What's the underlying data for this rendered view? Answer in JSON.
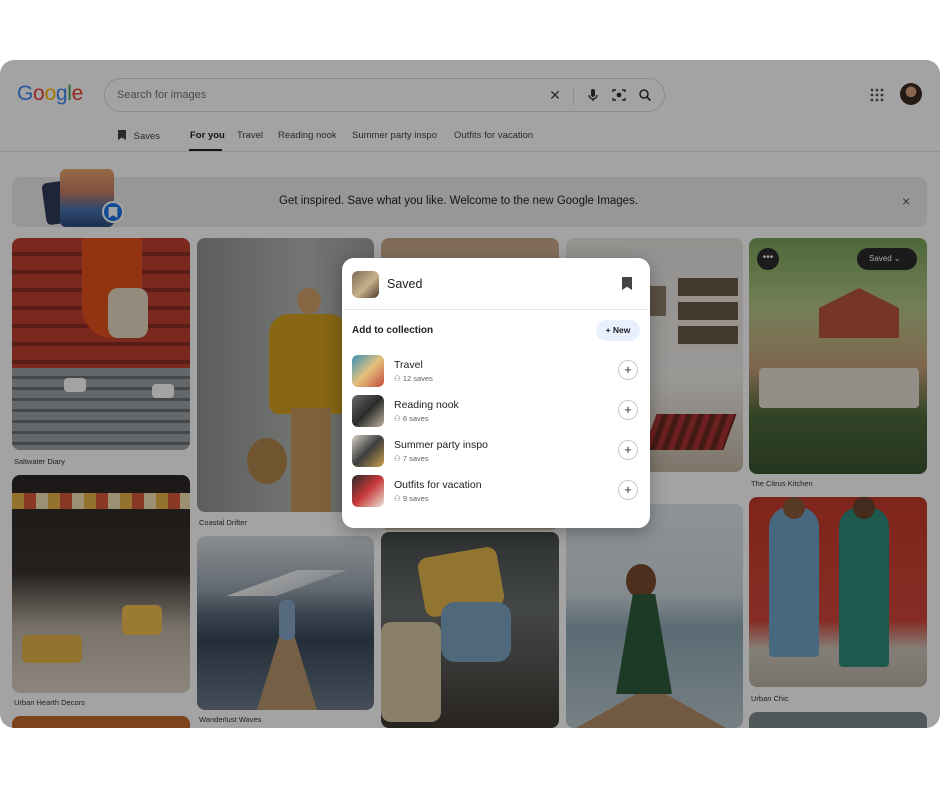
{
  "logo": "Google",
  "search": {
    "placeholder": "Search for images"
  },
  "tabs": [
    {
      "label": "Saves"
    },
    {
      "label": "For you"
    },
    {
      "label": "Travel"
    },
    {
      "label": "Reading nook"
    },
    {
      "label": "Summer party inspo"
    },
    {
      "label": "Outfits for vacation"
    }
  ],
  "banner": {
    "text": "Get inspired. Save what you like. Welcome to the new Google Images."
  },
  "captions": {
    "saltwater": "Saltwater Diary",
    "coastal": "Coastal Drifter",
    "citrus": "The Citrus Kitchen",
    "urban_hearth": "Urban Hearth Decors",
    "wanderlust": "Wanderlust Waves",
    "urban_chic": "Urban Chic"
  },
  "saved_chip": "Saved",
  "modal": {
    "title": "Saved",
    "add_label": "Add to collection",
    "new_label": "New",
    "collections": [
      {
        "name": "Travel",
        "count": "12 saves"
      },
      {
        "name": "Reading nook",
        "count": "6 saves"
      },
      {
        "name": "Summer party inspo",
        "count": "7 saves"
      },
      {
        "name": "Outfits for vacation",
        "count": "9 saves"
      }
    ]
  },
  "colors": {
    "google_blue": "#4285f4",
    "google_red": "#ea4335",
    "google_yellow": "#fbbc05",
    "google_green": "#34a853",
    "new_button_bg": "#e8f0fe"
  }
}
